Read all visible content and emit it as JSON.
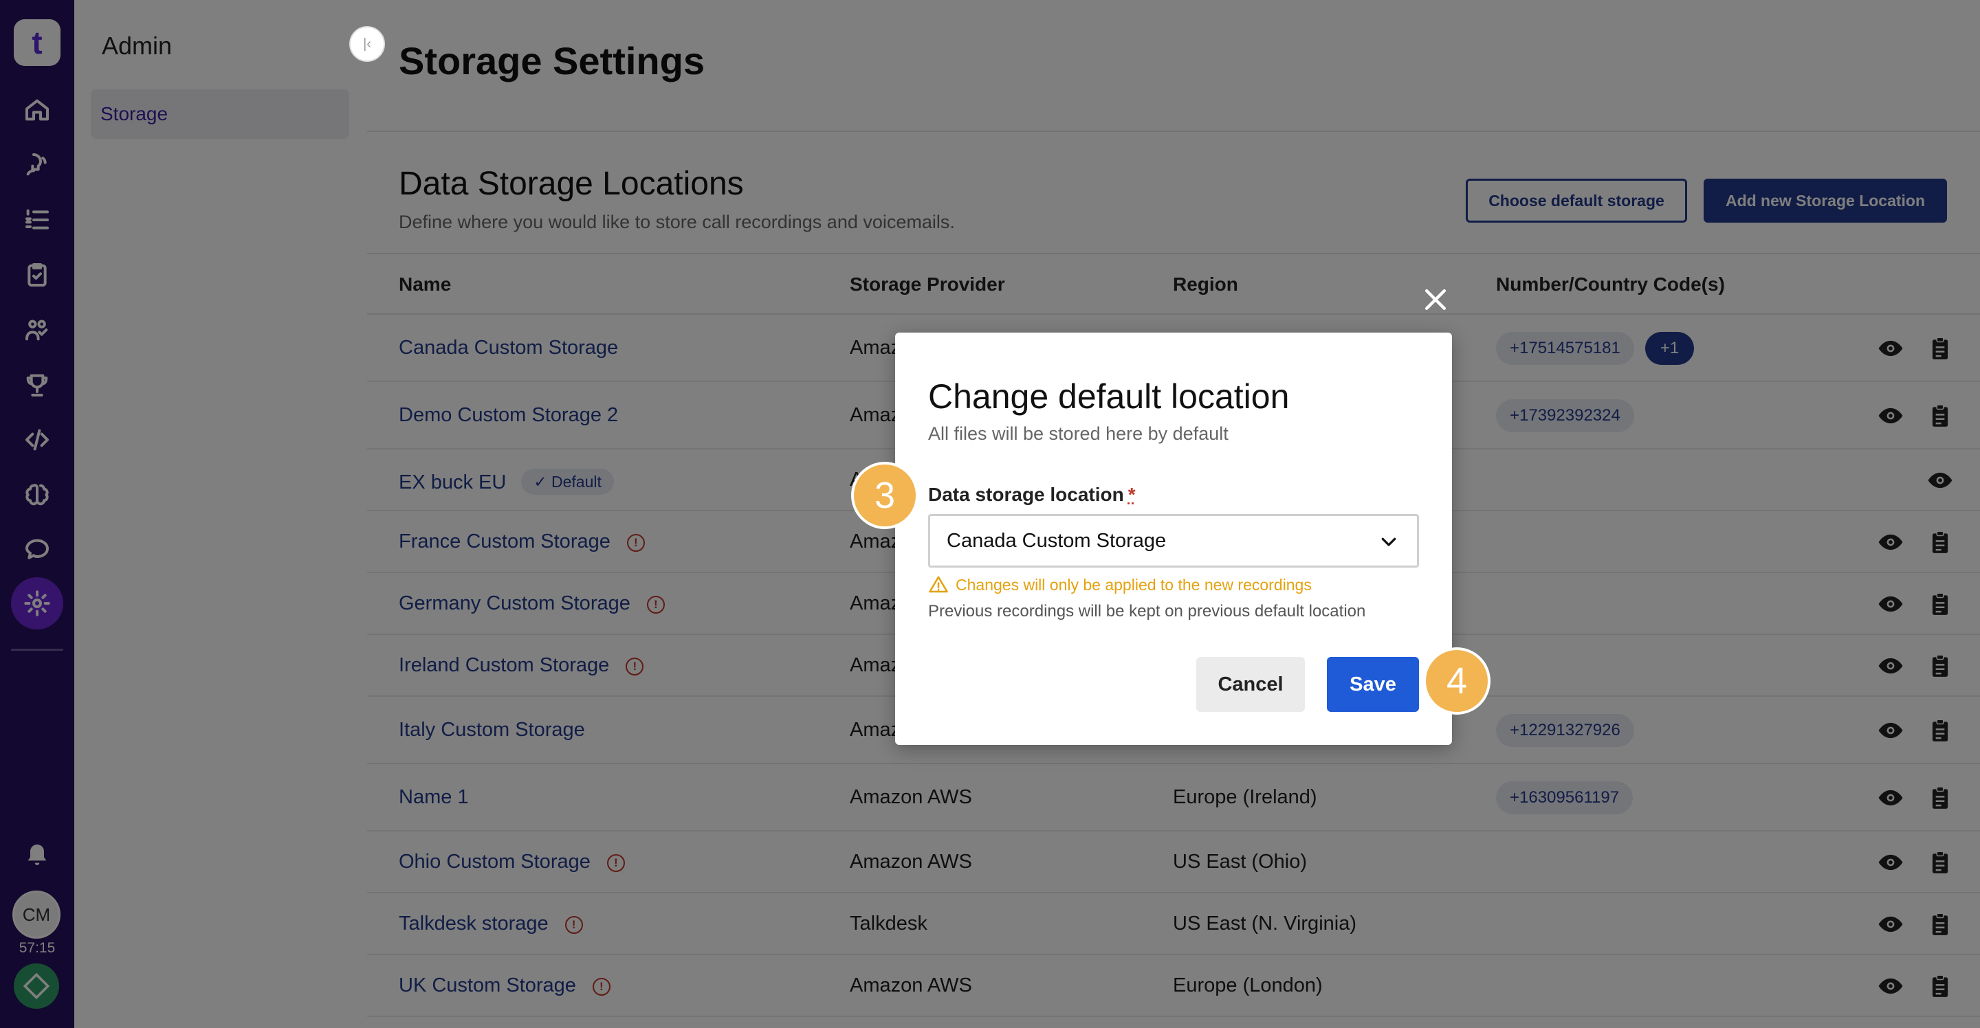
{
  "app": {
    "logo_text": "t",
    "timer": "57:15",
    "avatar_initials": "CM"
  },
  "rail": {
    "icons": [
      "home-icon",
      "speech-icon",
      "list-icon",
      "clipboard-icon",
      "team-icon",
      "trophy-icon",
      "code-icon",
      "brain-icon",
      "chat-icon",
      "settings-icon"
    ],
    "active": "settings-icon",
    "bottom": [
      "bell-icon",
      "avatar",
      "status-icon"
    ]
  },
  "sidebar": {
    "title": "Admin",
    "items": [
      {
        "label": "Storage",
        "active": true
      }
    ]
  },
  "page": {
    "title": "Storage Settings"
  },
  "section": {
    "title": "Data Storage Locations",
    "subtitle": "Define where you would like to store call recordings and voicemails.",
    "choose_default_label": "Choose default storage",
    "add_new_label": "Add new Storage Location"
  },
  "table": {
    "headers": {
      "name": "Name",
      "provider": "Storage Provider",
      "region": "Region",
      "numbers": "Number/Country Code(s)"
    },
    "default_badge": "Default",
    "rows": [
      {
        "name": "Canada Custom Storage",
        "provider": "Amazon AWS",
        "region": "",
        "numbers": [
          "+17514575181"
        ],
        "more": "+1",
        "warn": false
      },
      {
        "name": "Demo Custom Storage 2",
        "provider": "Amazon AWS",
        "region": "",
        "numbers": [
          "+17392392324"
        ],
        "more": "",
        "warn": false
      },
      {
        "name": "EX buck EU",
        "provider": "Amazon AWS",
        "region": "",
        "numbers": [],
        "more": "",
        "warn": false,
        "default": true
      },
      {
        "name": "France Custom Storage",
        "provider": "Amazon AWS",
        "region": "",
        "numbers": [],
        "more": "",
        "warn": true
      },
      {
        "name": "Germany Custom Storage",
        "provider": "Amazon AWS",
        "region": "",
        "numbers": [],
        "more": "",
        "warn": true
      },
      {
        "name": "Ireland Custom Storage",
        "provider": "Amazon AWS",
        "region": "",
        "numbers": [],
        "more": "",
        "warn": true
      },
      {
        "name": "Italy Custom Storage",
        "provider": "Amazon AWS",
        "region": "",
        "numbers": [
          "+12291327926"
        ],
        "more": "",
        "warn": false
      },
      {
        "name": "Name 1",
        "provider": "Amazon AWS",
        "region": "Europe (Ireland)",
        "numbers": [
          "+16309561197"
        ],
        "more": "",
        "warn": false
      },
      {
        "name": "Ohio Custom Storage",
        "provider": "Amazon AWS",
        "region": "US East (Ohio)",
        "numbers": [],
        "more": "",
        "warn": true
      },
      {
        "name": "Talkdesk storage",
        "provider": "Talkdesk",
        "region": "US East (N. Virginia)",
        "numbers": [],
        "more": "",
        "warn": true
      },
      {
        "name": "UK Custom Storage",
        "provider": "Amazon AWS",
        "region": "Europe (London)",
        "numbers": [],
        "more": "",
        "warn": true
      }
    ]
  },
  "dialog": {
    "title": "Change default location",
    "subtitle": "All files will be stored here by default",
    "field_label": "Data storage location",
    "required_mark": "*",
    "selected_value": "Canada Custom Storage",
    "warning": "Changes will only be applied to the new recordings",
    "note": "Previous recordings will be kept on previous default location",
    "cancel_label": "Cancel",
    "save_label": "Save"
  },
  "steps": {
    "first": "3",
    "second": "4"
  },
  "colors": {
    "rail": "#26105e",
    "accent": "#233a8c",
    "save": "#1f5bd6",
    "step": "#f2b552",
    "warning": "#e5a10e",
    "error": "#c0392b"
  }
}
